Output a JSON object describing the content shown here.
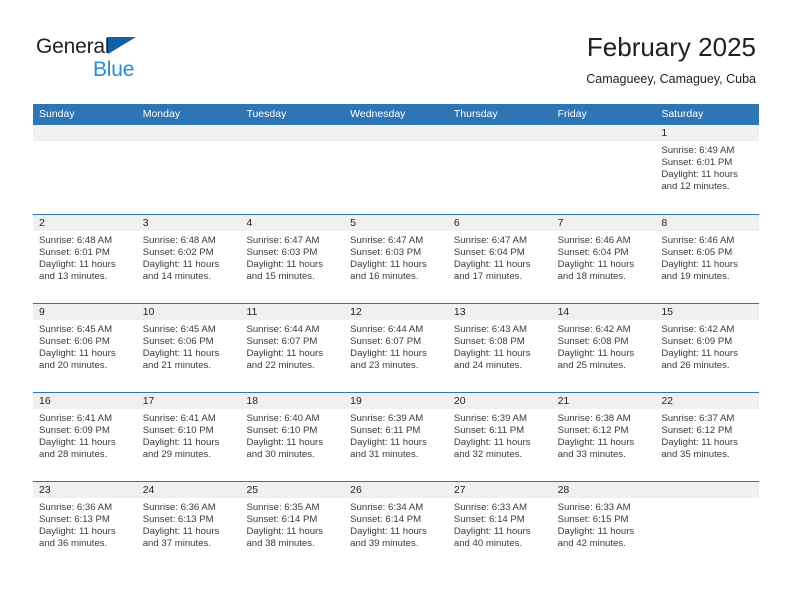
{
  "brand": {
    "name_dark": "General",
    "name_blue": "Blue",
    "triangle_icon": "triangle-icon",
    "accent_dark_blue": "#1060a8",
    "accent_light_blue": "#2e8bd4"
  },
  "header": {
    "title": "February 2025",
    "subtitle": "Camagueey, Camaguey, Cuba"
  },
  "theme": {
    "header_blue": "#2e75b6",
    "day_band_gray": "#f0f0f0",
    "text_dark": "#231f20"
  },
  "weekdays": [
    "Sunday",
    "Monday",
    "Tuesday",
    "Wednesday",
    "Thursday",
    "Friday",
    "Saturday"
  ],
  "weeks": [
    [
      {
        "day": "",
        "empty": true,
        "l1": "",
        "l2": "",
        "l3": "",
        "l4": ""
      },
      {
        "day": "",
        "empty": true,
        "l1": "",
        "l2": "",
        "l3": "",
        "l4": ""
      },
      {
        "day": "",
        "empty": true,
        "l1": "",
        "l2": "",
        "l3": "",
        "l4": ""
      },
      {
        "day": "",
        "empty": true,
        "l1": "",
        "l2": "",
        "l3": "",
        "l4": ""
      },
      {
        "day": "",
        "empty": true,
        "l1": "",
        "l2": "",
        "l3": "",
        "l4": ""
      },
      {
        "day": "",
        "empty": true,
        "l1": "",
        "l2": "",
        "l3": "",
        "l4": ""
      },
      {
        "day": "1",
        "empty": false,
        "l1": "Sunrise: 6:49 AM",
        "l2": "Sunset: 6:01 PM",
        "l3": "Daylight: 11 hours",
        "l4": "and 12 minutes."
      }
    ],
    [
      {
        "day": "2",
        "empty": false,
        "l1": "Sunrise: 6:48 AM",
        "l2": "Sunset: 6:01 PM",
        "l3": "Daylight: 11 hours",
        "l4": "and 13 minutes."
      },
      {
        "day": "3",
        "empty": false,
        "l1": "Sunrise: 6:48 AM",
        "l2": "Sunset: 6:02 PM",
        "l3": "Daylight: 11 hours",
        "l4": "and 14 minutes."
      },
      {
        "day": "4",
        "empty": false,
        "l1": "Sunrise: 6:47 AM",
        "l2": "Sunset: 6:03 PM",
        "l3": "Daylight: 11 hours",
        "l4": "and 15 minutes."
      },
      {
        "day": "5",
        "empty": false,
        "l1": "Sunrise: 6:47 AM",
        "l2": "Sunset: 6:03 PM",
        "l3": "Daylight: 11 hours",
        "l4": "and 16 minutes."
      },
      {
        "day": "6",
        "empty": false,
        "l1": "Sunrise: 6:47 AM",
        "l2": "Sunset: 6:04 PM",
        "l3": "Daylight: 11 hours",
        "l4": "and 17 minutes."
      },
      {
        "day": "7",
        "empty": false,
        "l1": "Sunrise: 6:46 AM",
        "l2": "Sunset: 6:04 PM",
        "l3": "Daylight: 11 hours",
        "l4": "and 18 minutes."
      },
      {
        "day": "8",
        "empty": false,
        "l1": "Sunrise: 6:46 AM",
        "l2": "Sunset: 6:05 PM",
        "l3": "Daylight: 11 hours",
        "l4": "and 19 minutes."
      }
    ],
    [
      {
        "day": "9",
        "empty": false,
        "l1": "Sunrise: 6:45 AM",
        "l2": "Sunset: 6:06 PM",
        "l3": "Daylight: 11 hours",
        "l4": "and 20 minutes."
      },
      {
        "day": "10",
        "empty": false,
        "l1": "Sunrise: 6:45 AM",
        "l2": "Sunset: 6:06 PM",
        "l3": "Daylight: 11 hours",
        "l4": "and 21 minutes."
      },
      {
        "day": "11",
        "empty": false,
        "l1": "Sunrise: 6:44 AM",
        "l2": "Sunset: 6:07 PM",
        "l3": "Daylight: 11 hours",
        "l4": "and 22 minutes."
      },
      {
        "day": "12",
        "empty": false,
        "l1": "Sunrise: 6:44 AM",
        "l2": "Sunset: 6:07 PM",
        "l3": "Daylight: 11 hours",
        "l4": "and 23 minutes."
      },
      {
        "day": "13",
        "empty": false,
        "l1": "Sunrise: 6:43 AM",
        "l2": "Sunset: 6:08 PM",
        "l3": "Daylight: 11 hours",
        "l4": "and 24 minutes."
      },
      {
        "day": "14",
        "empty": false,
        "l1": "Sunrise: 6:42 AM",
        "l2": "Sunset: 6:08 PM",
        "l3": "Daylight: 11 hours",
        "l4": "and 25 minutes."
      },
      {
        "day": "15",
        "empty": false,
        "l1": "Sunrise: 6:42 AM",
        "l2": "Sunset: 6:09 PM",
        "l3": "Daylight: 11 hours",
        "l4": "and 26 minutes."
      }
    ],
    [
      {
        "day": "16",
        "empty": false,
        "l1": "Sunrise: 6:41 AM",
        "l2": "Sunset: 6:09 PM",
        "l3": "Daylight: 11 hours",
        "l4": "and 28 minutes."
      },
      {
        "day": "17",
        "empty": false,
        "l1": "Sunrise: 6:41 AM",
        "l2": "Sunset: 6:10 PM",
        "l3": "Daylight: 11 hours",
        "l4": "and 29 minutes."
      },
      {
        "day": "18",
        "empty": false,
        "l1": "Sunrise: 6:40 AM",
        "l2": "Sunset: 6:10 PM",
        "l3": "Daylight: 11 hours",
        "l4": "and 30 minutes."
      },
      {
        "day": "19",
        "empty": false,
        "l1": "Sunrise: 6:39 AM",
        "l2": "Sunset: 6:11 PM",
        "l3": "Daylight: 11 hours",
        "l4": "and 31 minutes."
      },
      {
        "day": "20",
        "empty": false,
        "l1": "Sunrise: 6:39 AM",
        "l2": "Sunset: 6:11 PM",
        "l3": "Daylight: 11 hours",
        "l4": "and 32 minutes."
      },
      {
        "day": "21",
        "empty": false,
        "l1": "Sunrise: 6:38 AM",
        "l2": "Sunset: 6:12 PM",
        "l3": "Daylight: 11 hours",
        "l4": "and 33 minutes."
      },
      {
        "day": "22",
        "empty": false,
        "l1": "Sunrise: 6:37 AM",
        "l2": "Sunset: 6:12 PM",
        "l3": "Daylight: 11 hours",
        "l4": "and 35 minutes."
      }
    ],
    [
      {
        "day": "23",
        "empty": false,
        "l1": "Sunrise: 6:36 AM",
        "l2": "Sunset: 6:13 PM",
        "l3": "Daylight: 11 hours",
        "l4": "and 36 minutes."
      },
      {
        "day": "24",
        "empty": false,
        "l1": "Sunrise: 6:36 AM",
        "l2": "Sunset: 6:13 PM",
        "l3": "Daylight: 11 hours",
        "l4": "and 37 minutes."
      },
      {
        "day": "25",
        "empty": false,
        "l1": "Sunrise: 6:35 AM",
        "l2": "Sunset: 6:14 PM",
        "l3": "Daylight: 11 hours",
        "l4": "and 38 minutes."
      },
      {
        "day": "26",
        "empty": false,
        "l1": "Sunrise: 6:34 AM",
        "l2": "Sunset: 6:14 PM",
        "l3": "Daylight: 11 hours",
        "l4": "and 39 minutes."
      },
      {
        "day": "27",
        "empty": false,
        "l1": "Sunrise: 6:33 AM",
        "l2": "Sunset: 6:14 PM",
        "l3": "Daylight: 11 hours",
        "l4": "and 40 minutes."
      },
      {
        "day": "28",
        "empty": false,
        "l1": "Sunrise: 6:33 AM",
        "l2": "Sunset: 6:15 PM",
        "l3": "Daylight: 11 hours",
        "l4": "and 42 minutes."
      },
      {
        "day": "",
        "empty": true,
        "l1": "",
        "l2": "",
        "l3": "",
        "l4": ""
      }
    ]
  ]
}
